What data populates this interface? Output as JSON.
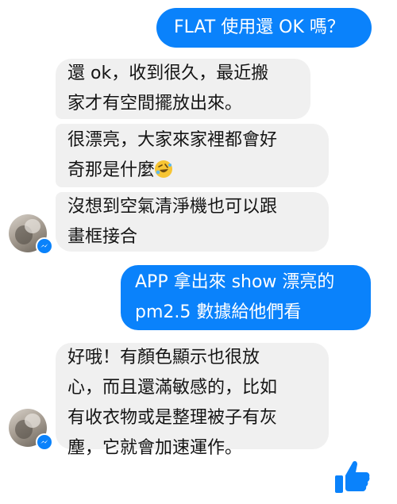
{
  "messages": [
    {
      "id": "b1",
      "sender": "me",
      "text": "FLAT 使用還 OK 嗎？"
    },
    {
      "id": "b2",
      "sender": "friend",
      "lines": [
        "還 ok，收到很久，最近搬",
        "家才有空間擺放出來。"
      ]
    },
    {
      "id": "b3",
      "sender": "friend",
      "lines": [
        "很漂亮，大家來家裡都會好",
        "奇那是什麼"
      ],
      "emoji": "rolling-on-floor-laughing-emoji"
    },
    {
      "id": "b4",
      "sender": "friend",
      "lines": [
        "沒想到空氣清淨機也可以跟",
        "畫框接合"
      ]
    },
    {
      "id": "b5",
      "sender": "me",
      "lines": [
        "APP 拿出來 show 漂亮的",
        "pm2.5 數據給他們看"
      ]
    },
    {
      "id": "b6",
      "sender": "friend",
      "lines": [
        "好哦！有顏色顯示也很放",
        "心，而且還滿敏感的，比如",
        "有收衣物或是整理被子有灰",
        "塵，它就會加速運作。"
      ]
    }
  ],
  "icons": {
    "like": "thumbs-up-icon",
    "badge": "messenger-icon"
  },
  "colors": {
    "outgoing_bubble": "#0a82fb",
    "incoming_bubble": "#f0f0f0",
    "incoming_text": "#141414",
    "like_button": "#0a82fb"
  }
}
